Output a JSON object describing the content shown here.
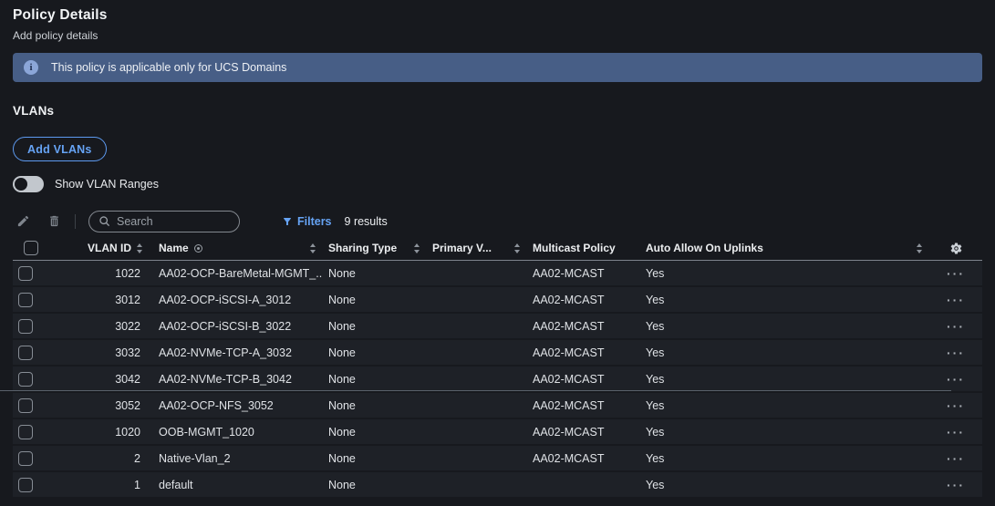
{
  "page": {
    "title": "Policy Details",
    "subtitle": "Add policy details"
  },
  "banner": {
    "text": "This policy is applicable only for UCS Domains"
  },
  "vlans_section": {
    "title": "VLANs",
    "add_button_label": "Add VLANs",
    "show_ranges_label": "Show VLAN Ranges",
    "show_ranges_state": "off"
  },
  "toolbar": {
    "search_placeholder": "Search",
    "filters_label": "Filters",
    "results_text": "9 results"
  },
  "table": {
    "headers": {
      "vlan_id": "VLAN ID",
      "name": "Name",
      "sharing_type": "Sharing Type",
      "primary_vlan": "Primary V...",
      "multicast_policy": "Multicast Policy",
      "auto_allow": "Auto Allow On Uplinks"
    },
    "rows": [
      {
        "vlan_id": "1022",
        "name": "AA02-OCP-BareMetal-MGMT_...",
        "sharing_type": "None",
        "primary_vlan": "",
        "multicast_policy": "AA02-MCAST",
        "auto_allow": "Yes"
      },
      {
        "vlan_id": "3012",
        "name": "AA02-OCP-iSCSI-A_3012",
        "sharing_type": "None",
        "primary_vlan": "",
        "multicast_policy": "AA02-MCAST",
        "auto_allow": "Yes"
      },
      {
        "vlan_id": "3022",
        "name": "AA02-OCP-iSCSI-B_3022",
        "sharing_type": "None",
        "primary_vlan": "",
        "multicast_policy": "AA02-MCAST",
        "auto_allow": "Yes"
      },
      {
        "vlan_id": "3032",
        "name": "AA02-NVMe-TCP-A_3032",
        "sharing_type": "None",
        "primary_vlan": "",
        "multicast_policy": "AA02-MCAST",
        "auto_allow": "Yes"
      },
      {
        "vlan_id": "3042",
        "name": "AA02-NVMe-TCP-B_3042",
        "sharing_type": "None",
        "primary_vlan": "",
        "multicast_policy": "AA02-MCAST",
        "auto_allow": "Yes"
      },
      {
        "vlan_id": "3052",
        "name": "AA02-OCP-NFS_3052",
        "sharing_type": "None",
        "primary_vlan": "",
        "multicast_policy": "AA02-MCAST",
        "auto_allow": "Yes"
      },
      {
        "vlan_id": "1020",
        "name": "OOB-MGMT_1020",
        "sharing_type": "None",
        "primary_vlan": "",
        "multicast_policy": "AA02-MCAST",
        "auto_allow": "Yes"
      },
      {
        "vlan_id": "2",
        "name": "Native-Vlan_2",
        "sharing_type": "None",
        "primary_vlan": "",
        "multicast_policy": "AA02-MCAST",
        "auto_allow": "Yes"
      },
      {
        "vlan_id": "1",
        "name": "default",
        "sharing_type": "None",
        "primary_vlan": "",
        "multicast_policy": "",
        "auto_allow": "Yes"
      }
    ],
    "divider_after_row_index": 4
  },
  "icons": {
    "more_options": "···",
    "info": "i"
  },
  "colors": {
    "accent_blue": "#66a3f4",
    "banner_bg": "#475e86",
    "page_bg": "#17191e",
    "row_bg": "#1e2127"
  }
}
